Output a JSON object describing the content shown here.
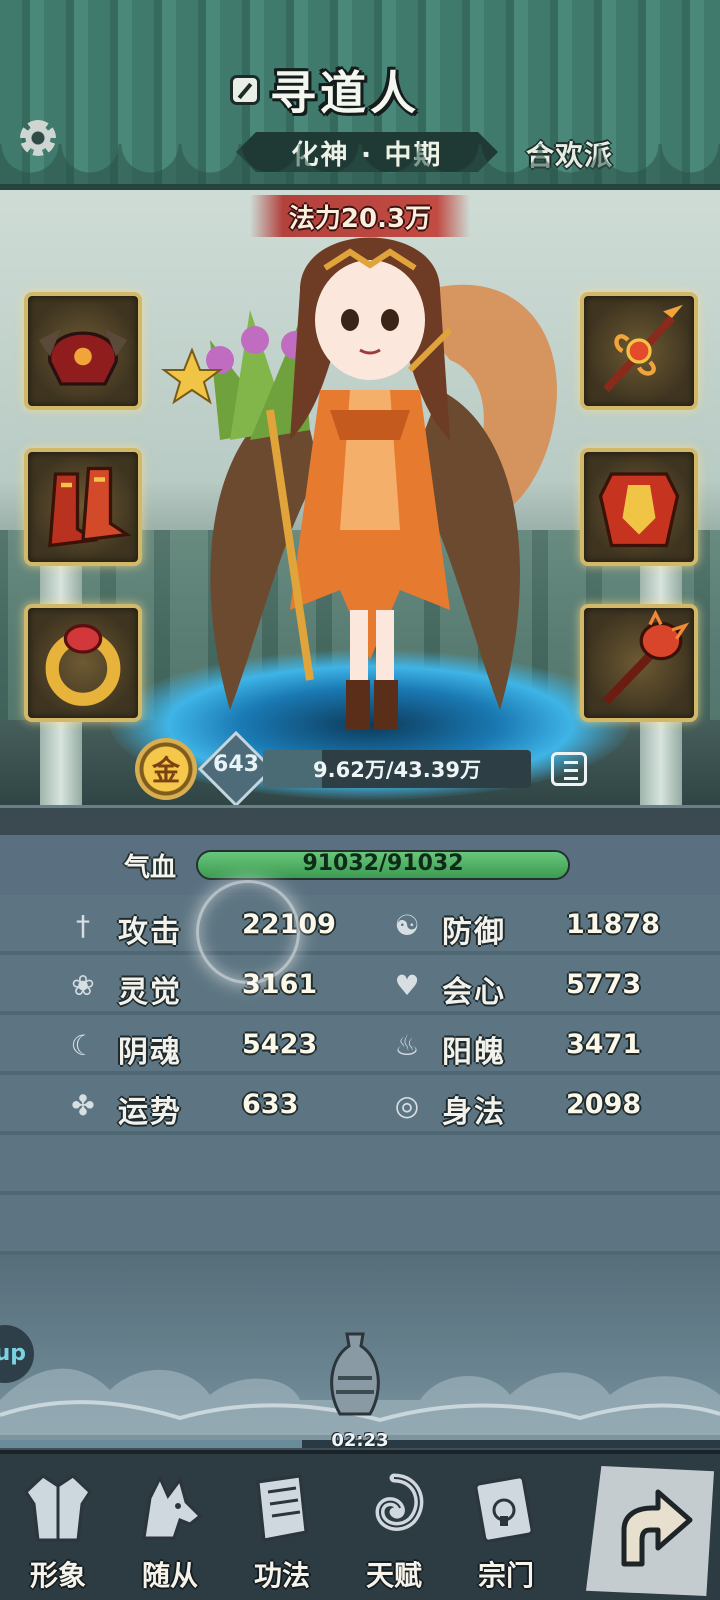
{
  "header": {
    "player_name": "寻道人",
    "realm": "化神 · 中期",
    "sect": "合欢派"
  },
  "stage": {
    "power": "法力20.3万",
    "element_glyph": "金",
    "level": "643",
    "exp_text": "9.62万/43.39万",
    "exp_progress": 0.222
  },
  "equipment": {
    "left": [
      "helmet-icon",
      "boots-icon",
      "ring-icon"
    ],
    "right": [
      "spear-weapon-icon",
      "armor-icon",
      "mace-icon"
    ]
  },
  "stats": {
    "hp_label": "气血",
    "hp_text": "91032/91032",
    "hp_progress": 1.0,
    "rows": [
      {
        "label": "攻击",
        "value": "22109",
        "icon": "sword-icon"
      },
      {
        "label": "防御",
        "value": "11878",
        "icon": "yinyang-icon"
      },
      {
        "label": "灵觉",
        "value": "3161",
        "icon": "lotus-icon"
      },
      {
        "label": "会心",
        "value": "5773",
        "icon": "heart-icon"
      },
      {
        "label": "阴魂",
        "value": "5423",
        "icon": "yin-soul-icon"
      },
      {
        "label": "阳魄",
        "value": "3471",
        "icon": "yang-soul-icon"
      },
      {
        "label": "运势",
        "value": "633",
        "icon": "clover-icon"
      },
      {
        "label": "身法",
        "value": "2098",
        "icon": "swirl-icon"
      }
    ]
  },
  "side": {
    "up_label": "up"
  },
  "timer": {
    "text": "02:23",
    "progress": 0.42
  },
  "nav": {
    "items": [
      {
        "label": "形象",
        "icon": "robe-icon"
      },
      {
        "label": "随从",
        "icon": "wolf-icon"
      },
      {
        "label": "功法",
        "icon": "book-icon"
      },
      {
        "label": "天赋",
        "icon": "whirlpool-icon"
      },
      {
        "label": "宗门",
        "icon": "sect-scroll-icon"
      }
    ],
    "back_icon": "return-arrow-icon"
  },
  "colors": {
    "header_teal": "#3f7a6c",
    "hp_green": "#4caf5f",
    "frame_gold": "#d2b96a",
    "stats_slate": "#5d7582"
  }
}
